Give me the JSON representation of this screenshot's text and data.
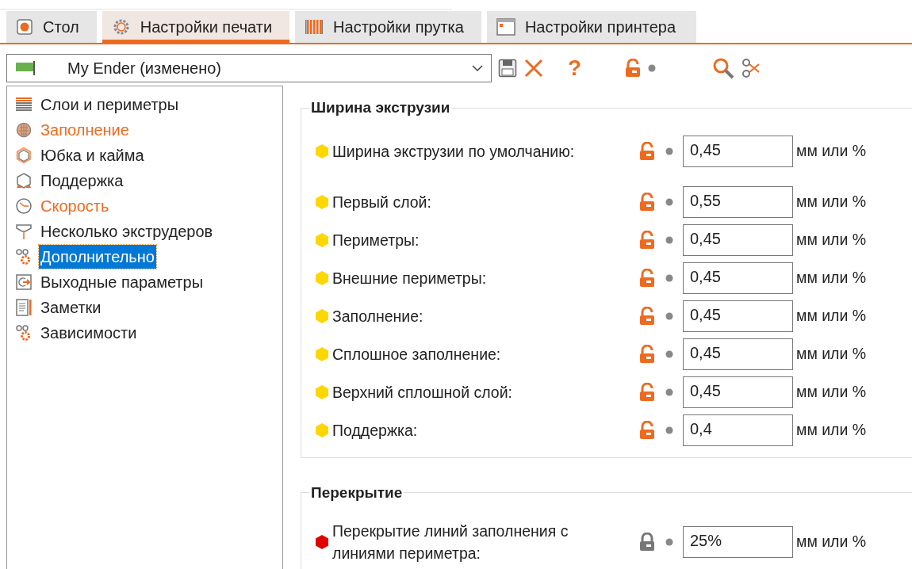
{
  "tabs": [
    {
      "label": "Стол",
      "kind": "plater",
      "selected": false
    },
    {
      "label": "Настройки печати",
      "kind": "print",
      "selected": true
    },
    {
      "label": "Настройки прутка",
      "kind": "filament",
      "selected": false
    },
    {
      "label": "Настройки принтера",
      "kind": "printer",
      "selected": false
    }
  ],
  "preset": {
    "value": "My Ender (изменено)"
  },
  "toolbar": {
    "help": "?",
    "locked": false
  },
  "sidebar": {
    "items": [
      {
        "label": "Слои и периметры",
        "kind": "layers",
        "modified": false,
        "selected": false
      },
      {
        "label": "Заполнение",
        "kind": "infill",
        "modified": true,
        "selected": false
      },
      {
        "label": "Юбка и кайма",
        "kind": "skirt",
        "modified": false,
        "selected": false
      },
      {
        "label": "Поддержка",
        "kind": "support",
        "modified": false,
        "selected": false
      },
      {
        "label": "Скорость",
        "kind": "speed",
        "modified": true,
        "selected": false
      },
      {
        "label": "Несколько экструдеров",
        "kind": "extruders",
        "modified": false,
        "selected": false
      },
      {
        "label": "Дополнительно",
        "kind": "gears",
        "modified": false,
        "selected": true
      },
      {
        "label": "Выходные параметры",
        "kind": "output",
        "modified": false,
        "selected": false
      },
      {
        "label": "Заметки",
        "kind": "notes",
        "modified": false,
        "selected": false
      },
      {
        "label": "Зависимости",
        "kind": "gears",
        "modified": false,
        "selected": false
      }
    ]
  },
  "groups": [
    {
      "title": "Ширина экструзии",
      "rows": [
        {
          "label": "Ширина экструзии по умолчанию:",
          "color": "#ffd700",
          "locked": false,
          "value": "0,45",
          "unit": "мм или %"
        },
        {
          "label": "Первый слой:",
          "color": "#ffd700",
          "locked": false,
          "value": "0,55",
          "unit": "мм или %"
        },
        {
          "label": "Периметры:",
          "color": "#ffd700",
          "locked": false,
          "value": "0,45",
          "unit": "мм или %"
        },
        {
          "label": "Внешние периметры:",
          "color": "#ffd700",
          "locked": false,
          "value": "0,45",
          "unit": "мм или %"
        },
        {
          "label": "Заполнение:",
          "color": "#ffd700",
          "locked": false,
          "value": "0,45",
          "unit": "мм или %"
        },
        {
          "label": "Сплошное заполнение:",
          "color": "#ffd700",
          "locked": false,
          "value": "0,45",
          "unit": "мм или %"
        },
        {
          "label": "Верхний сплошной слой:",
          "color": "#ffd700",
          "locked": false,
          "value": "0,45",
          "unit": "мм или %"
        },
        {
          "label": "Поддержка:",
          "color": "#ffd700",
          "locked": false,
          "value": "0,4",
          "unit": "мм или %"
        }
      ]
    },
    {
      "title": "Перекрытие",
      "rows": [
        {
          "label": "Перекрытие линий заполнения с линиями периметра:",
          "color": "#e00000",
          "locked": true,
          "value": "25%",
          "unit": "мм или %"
        }
      ]
    }
  ]
}
